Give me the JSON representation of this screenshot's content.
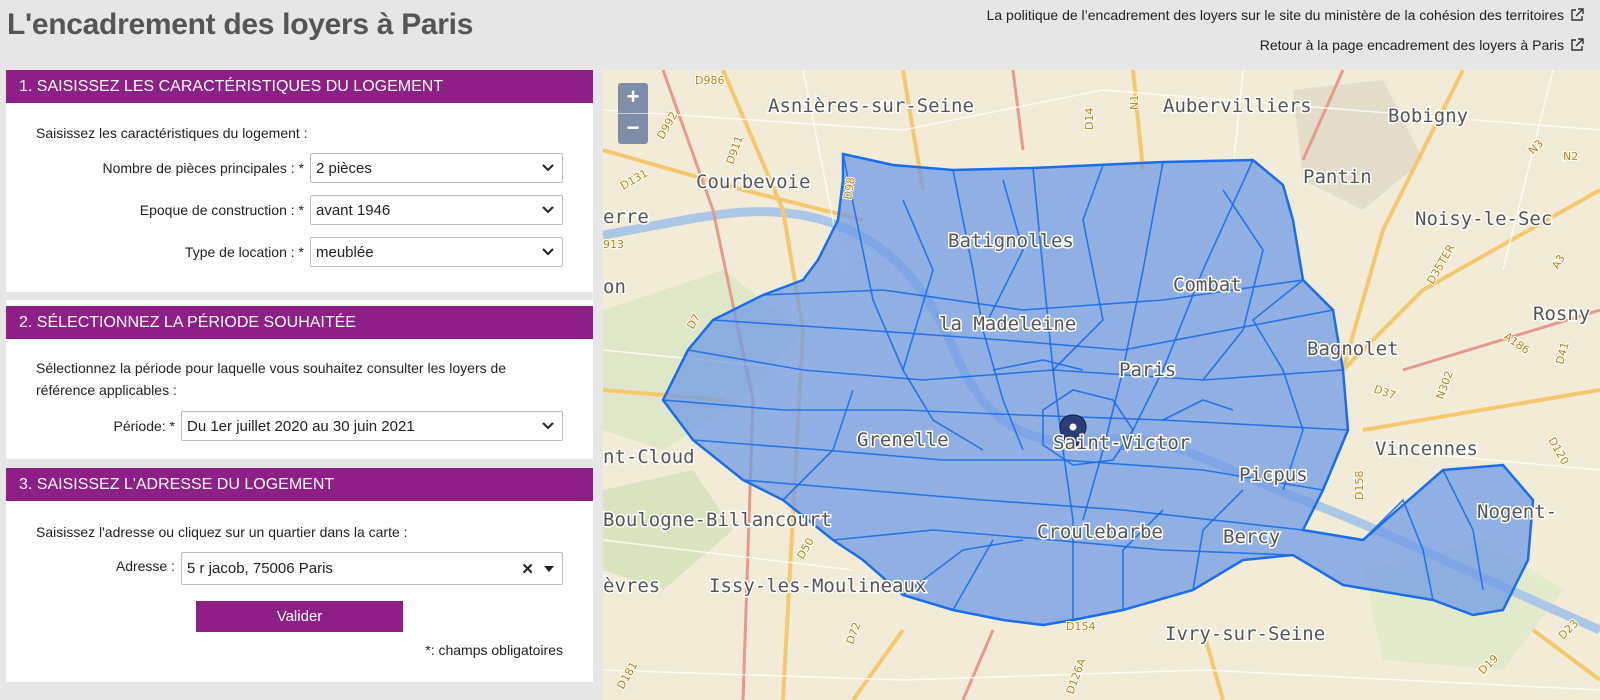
{
  "header": {
    "title": "L'encadrement des loyers à Paris",
    "link_ministere": "La politique de l’encadrement des loyers sur le site du ministère de la cohésion des territoires",
    "link_retour": "Retour à la page encadrement des loyers à Paris"
  },
  "section1": {
    "title": "1. SAISISSEZ LES CARACTÉRISTIQUES DU LOGEMENT",
    "intro": "Saisissez les caractéristiques du logement :",
    "pieces_label": "Nombre de pièces principales : *",
    "pieces_value": "2 pièces",
    "epoque_label": "Epoque de construction : *",
    "epoque_value": "avant 1946",
    "type_label": "Type de location : *",
    "type_value": "meublée"
  },
  "section2": {
    "title": "2. SÉLECTIONNEZ LA PÉRIODE SOUHAITÉE",
    "intro": "Sélectionnez la période pour laquelle vous souhaitez consulter les loyers de référence applicables :",
    "periode_label": "Période: *",
    "periode_value": "Du 1er juillet 2020 au 30 juin 2021"
  },
  "section3": {
    "title": "3. SAISISSEZ L'ADRESSE DU LOGEMENT",
    "intro": "Saisissez l'adresse ou cliquez sur un quartier dans la carte :",
    "adresse_label": "Adresse :",
    "adresse_value": "5 r jacob, 75006 Paris",
    "clear_symbol": "✕",
    "valider_label": "Valider",
    "required_note": "*: champs obligatoires"
  },
  "map": {
    "zoom_in": "+",
    "zoom_out": "−",
    "overlay_color": "#6f9be6",
    "overlay_stroke": "#1a6fe8",
    "marker_icon": "map-pin-icon",
    "place_labels": [
      "Asnières-sur-Seine",
      "Aubervilliers",
      "Bobigny",
      "Courbevoie",
      "Pantin",
      "Noisy-le-Sec",
      "erre",
      "Batignolles",
      "Combat",
      "Rosny",
      "on",
      "la Madeleine",
      "Bagnolet",
      "Paris",
      "Saint-Victor",
      "Grenelle",
      "Vincennes",
      "nt-Cloud",
      "Picpus",
      "Boulogne-Billancourt",
      "Nogent-",
      "Croulebarbe",
      "Bercy",
      "èvres",
      "Issy-les-Moulineaux",
      "Ivry-sur-Seine"
    ],
    "road_labels": [
      "D986",
      "D992",
      "D911",
      "D98",
      "D14",
      "N1",
      "D131",
      "913",
      "D7",
      "D50",
      "D72",
      "D181",
      "D126A",
      "D154",
      "D37",
      "N3",
      "D35TER",
      "A186",
      "A3",
      "D41",
      "N302",
      "D120",
      "D158",
      "D23",
      "N2",
      "D19"
    ]
  }
}
